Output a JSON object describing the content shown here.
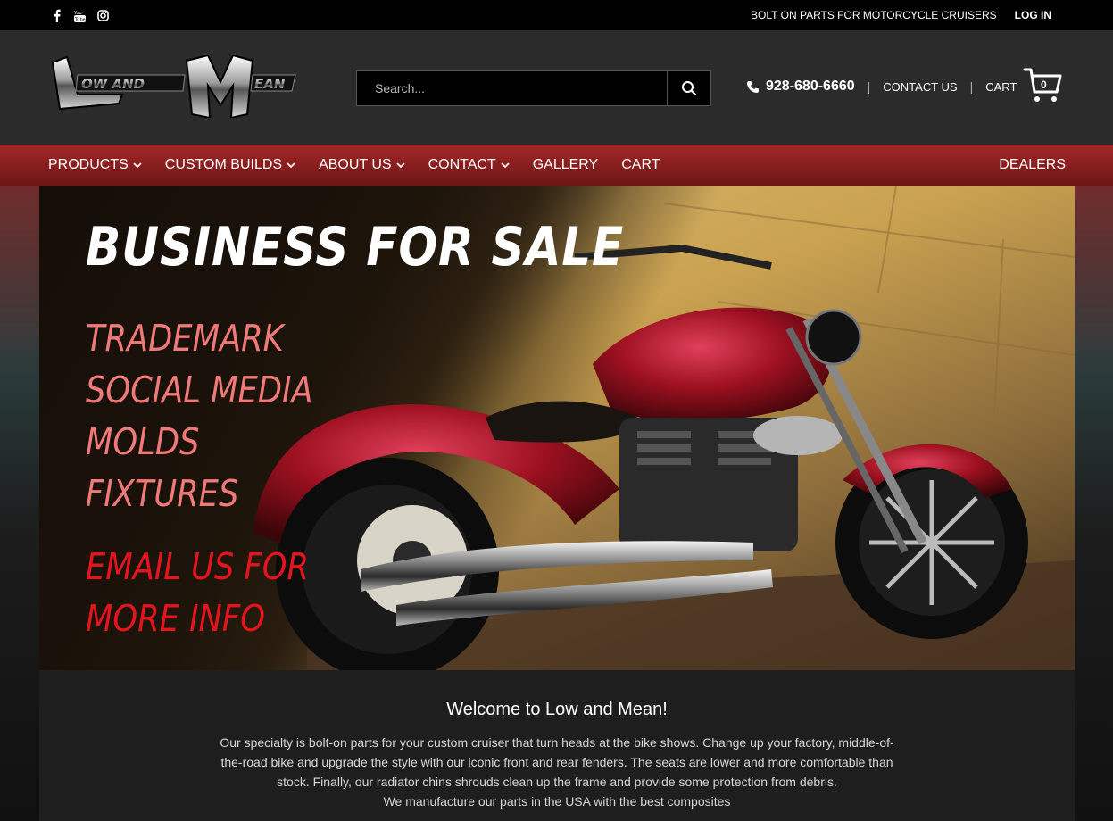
{
  "topbar": {
    "social": [
      "facebook-icon",
      "youtube-icon",
      "instagram-icon"
    ],
    "tagline": "BOLT ON PARTS FOR MOTORCYCLE CRUISERS",
    "login": "LOG IN"
  },
  "header": {
    "logo_text": "Low and Mean",
    "search_placeholder": "Search...",
    "phone": "928-680-6660",
    "contact_us": "CONTACT US",
    "cart": "CART",
    "cart_count": "0",
    "separator": "|"
  },
  "nav": {
    "items": [
      {
        "label": "PRODUCTS",
        "dropdown": true
      },
      {
        "label": "CUSTOM BUILDS",
        "dropdown": true
      },
      {
        "label": "ABOUT US",
        "dropdown": true
      },
      {
        "label": "CONTACT",
        "dropdown": true
      },
      {
        "label": "GALLERY",
        "dropdown": false
      },
      {
        "label": "CART",
        "dropdown": false
      }
    ],
    "dealers": "DEALERS"
  },
  "hero": {
    "headline": "BUSINESS FOR SALE",
    "assets": [
      "TRADEMARK",
      "SOCIAL MEDIA",
      "MOLDS",
      "FIXTURES"
    ],
    "cta_line1": "EMAIL US FOR",
    "cta_line2": "MORE INFO"
  },
  "welcome": {
    "title": "Welcome to Low and Mean!",
    "paragraph": "Our specialty is bolt-on parts for your custom cruiser that turn heads at the bike shows. Change up your factory, middle-of-the-road bike and upgrade the style with our iconic front and rear fenders. The seats are lower and more comfortable than stock. Finally, our radiator chins shrouds clean up the frame and provide some protection from debris.",
    "paragraph2": "We manufacture our parts in the USA with the best composites"
  },
  "colors": {
    "nav_red": "#a32828",
    "asset_pink": "#f07a7a",
    "cta_red": "#e6141e"
  }
}
